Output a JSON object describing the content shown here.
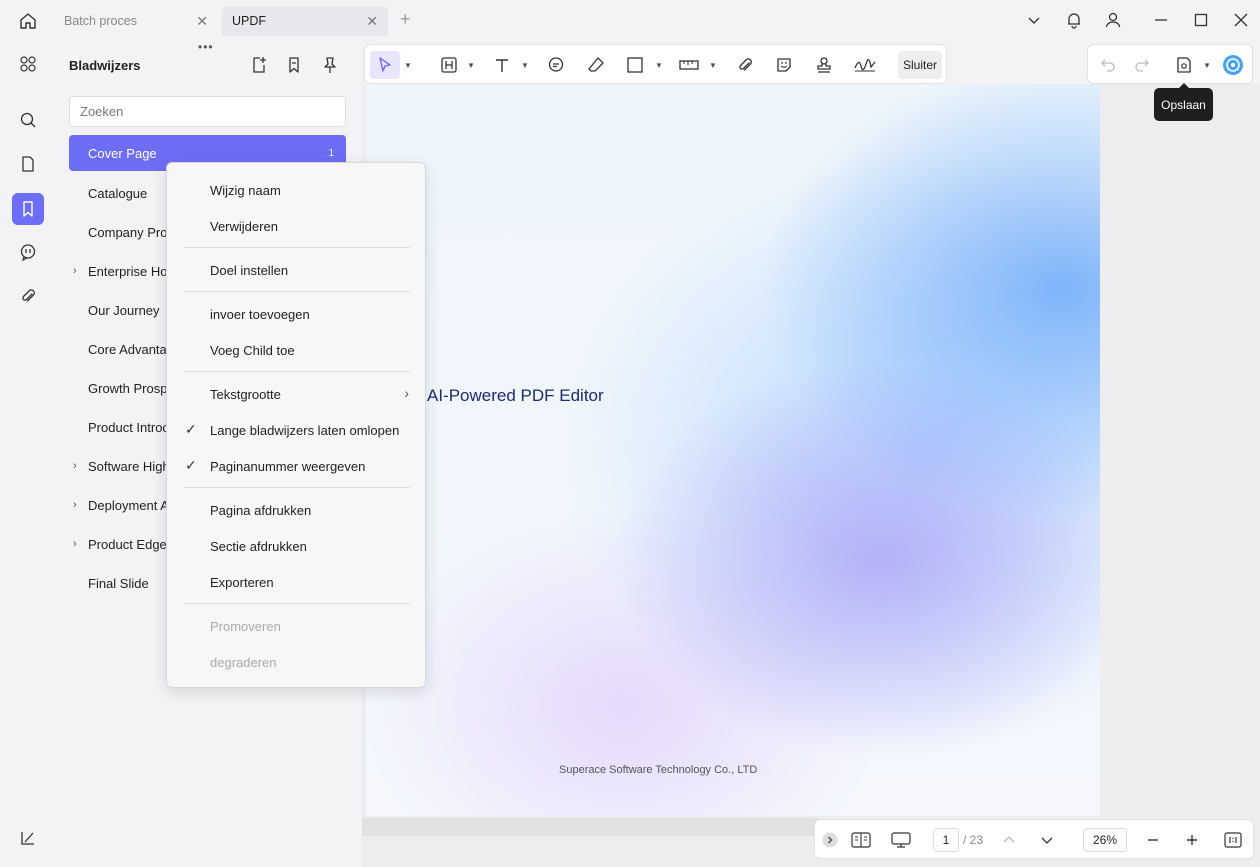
{
  "titlebar": {
    "tabs": [
      {
        "label": "Batch proces",
        "active": false
      },
      {
        "label": "UPDF",
        "active": true
      }
    ],
    "new_tab_icon": "plus-icon"
  },
  "sidebar": {
    "title": "Bladwijzers",
    "search_placeholder": "Zoeken",
    "items": [
      {
        "label": "Cover Page",
        "page": "1",
        "selected": true,
        "expandable": false
      },
      {
        "label": "Catalogue",
        "expandable": false
      },
      {
        "label": "Company Pro",
        "expandable": false
      },
      {
        "label": "Enterprise Ho",
        "expandable": true
      },
      {
        "label": "Our Journey",
        "expandable": false
      },
      {
        "label": "Core Advanta",
        "expandable": false
      },
      {
        "label": "Growth Prosp",
        "expandable": false
      },
      {
        "label": "Product Introc",
        "expandable": false
      },
      {
        "label": "Software High",
        "expandable": true
      },
      {
        "label": "Deployment A",
        "expandable": true
      },
      {
        "label": "Product Edge",
        "expandable": true
      },
      {
        "label": "Final Slide",
        "expandable": false
      }
    ]
  },
  "toolbar": {
    "close_label": "Sluiter",
    "save_tooltip": "Opslaan"
  },
  "context_menu": {
    "items": [
      {
        "label": "Wijzig naam"
      },
      {
        "label": "Verwijderen"
      },
      {
        "label": "Doel instellen"
      },
      {
        "label": "invoer toevoegen"
      },
      {
        "label": "Voeg Child toe"
      },
      {
        "label": "Tekstgrootte"
      },
      {
        "label": "Lange bladwijzers laten omlopen",
        "checked": true
      },
      {
        "label": "Paginanummer weergeven",
        "checked": true
      },
      {
        "label": "Pagina afdrukken"
      },
      {
        "label": "Sectie afdrukken"
      },
      {
        "label": "Exporteren"
      },
      {
        "label": "Promoveren",
        "disabled": true
      },
      {
        "label": "degraderen",
        "disabled": true
      }
    ]
  },
  "document": {
    "page_title": "AI-Powered PDF Editor",
    "footer": "Superace Software Technology Co., LTD"
  },
  "bottombar": {
    "current_page": "1",
    "total_pages": "/ 23",
    "zoom": "26%"
  },
  "colors": {
    "accent": "#6d6df7",
    "tooltip_bg": "#1f1f1f"
  }
}
